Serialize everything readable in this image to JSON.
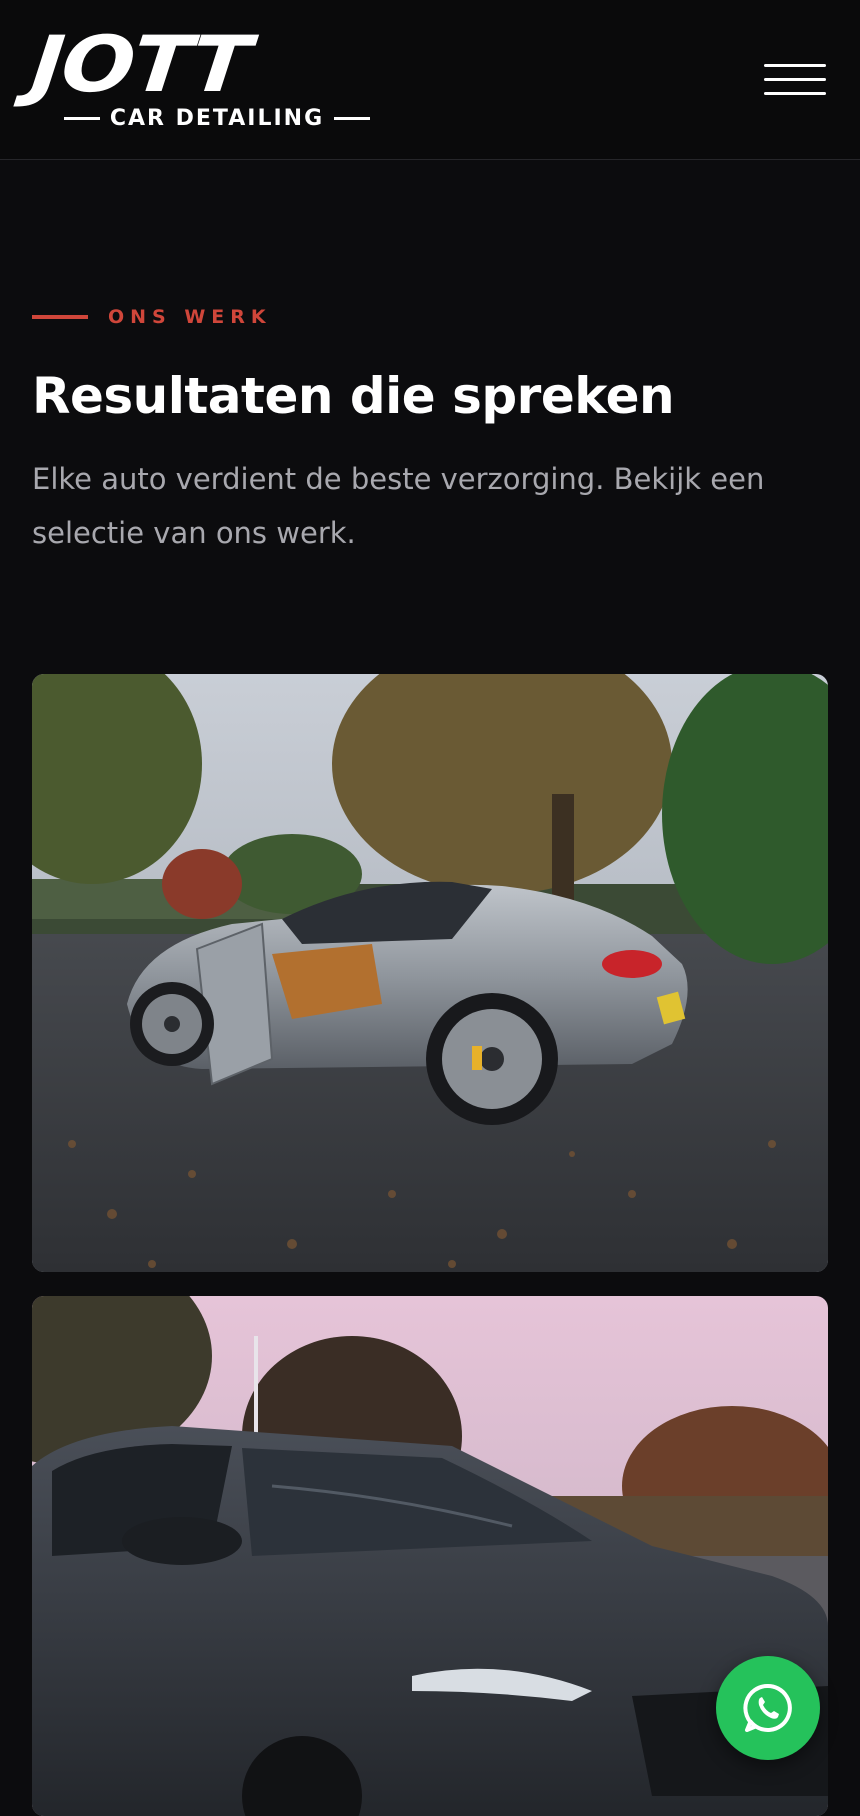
{
  "header": {
    "logo_main": "JOTT",
    "logo_sub": "CAR DETAILING",
    "menu_icon": "hamburger-menu-icon"
  },
  "section": {
    "eyebrow": "ONS WERK",
    "title": "Resultaten die spreken",
    "intro": "Elke auto verdient de beste verzorging. Bekijk een selectie van ons werk."
  },
  "gallery": [
    {
      "subject": "grey-sports-car-photo"
    },
    {
      "subject": "dark-grey-suv-photo"
    }
  ],
  "floating": {
    "whatsapp_icon": "whatsapp-icon"
  },
  "colors": {
    "background": "#0c0c0e",
    "accent": "#d0463a",
    "whatsapp": "#25c25b"
  }
}
